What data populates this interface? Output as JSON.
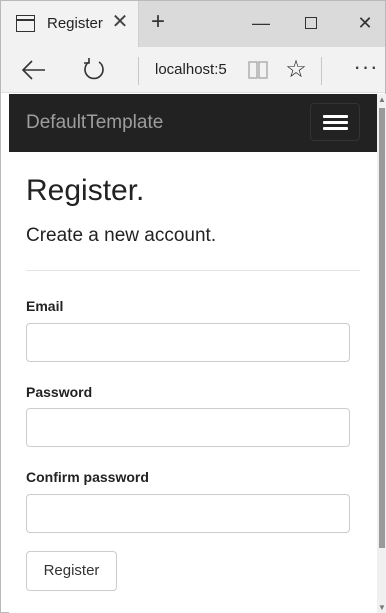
{
  "browser": {
    "tab_title": "Register",
    "tab_close": "✕",
    "new_tab": "+",
    "window_min": "—",
    "window_close": "✕",
    "address": "localhost:5",
    "more": "···",
    "star": "☆"
  },
  "app": {
    "brand": "DefaultTemplate",
    "navbar_bg": "#222222",
    "brand_color": "#9d9d9d"
  },
  "page": {
    "title": "Register.",
    "subtitle": "Create a new account.",
    "fields": {
      "email_label": "Email",
      "email_value": "",
      "password_label": "Password",
      "password_value": "",
      "confirm_label": "Confirm password",
      "confirm_value": ""
    },
    "register_button": "Register"
  },
  "icons": {
    "page_icon": "page-icon",
    "back": "back-arrow-icon",
    "refresh": "refresh-icon",
    "reading_view": "reading-view-icon",
    "favorite": "star-icon",
    "more": "more-icon",
    "menu": "hamburger-icon"
  }
}
